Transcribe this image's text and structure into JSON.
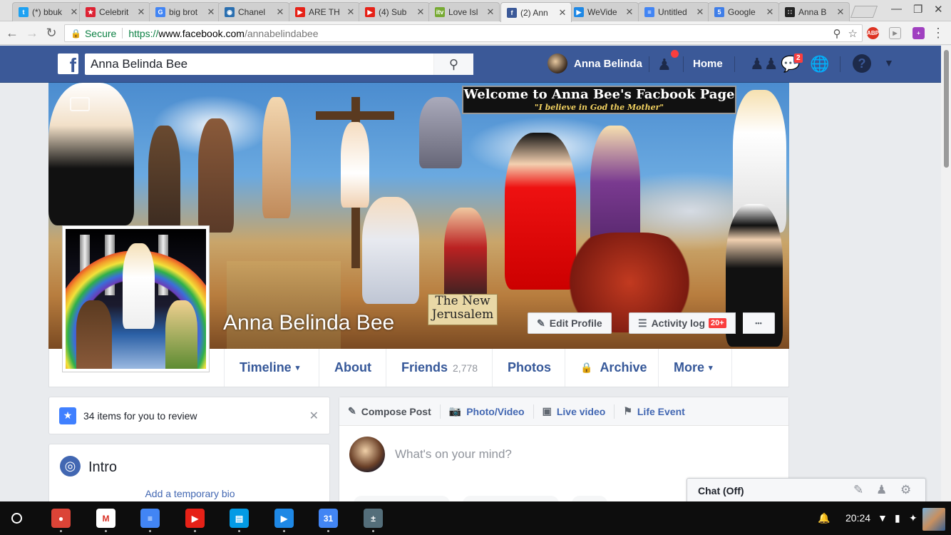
{
  "browser": {
    "tabs": [
      {
        "title": "(*) bbuk",
        "favicon": "twitter-icon",
        "color": "#1da1f2",
        "glyph": "t"
      },
      {
        "title": "Celebrit",
        "favicon": "celebrity-icon",
        "color": "#d23",
        "glyph": "★"
      },
      {
        "title": "big brot",
        "favicon": "google-icon",
        "color": "#4285f4",
        "glyph": "G"
      },
      {
        "title": "Chanel",
        "favicon": "eye-icon",
        "color": "#2a6fb0",
        "glyph": "◉"
      },
      {
        "title": "ARE TH",
        "favicon": "youtube-icon",
        "color": "#e62117",
        "glyph": "▶"
      },
      {
        "title": "(4) Sub",
        "favicon": "youtube-icon",
        "color": "#e62117",
        "glyph": "▶"
      },
      {
        "title": "Love Isl",
        "favicon": "itv-icon",
        "color": "#7a3",
        "glyph": "itv"
      },
      {
        "title": "(2) Ann",
        "favicon": "facebook-icon",
        "color": "#3b5998",
        "glyph": "f"
      },
      {
        "title": "WeVide",
        "favicon": "wevideo-icon",
        "color": "#1e88e5",
        "glyph": "▶"
      },
      {
        "title": "Untitled",
        "favicon": "docs-icon",
        "color": "#4285f4",
        "glyph": "≡"
      },
      {
        "title": "Google",
        "favicon": "sites-icon",
        "color": "#3f7ee8",
        "glyph": "5"
      },
      {
        "title": "Anna B",
        "favicon": "people-icon",
        "color": "#222",
        "glyph": "∷"
      }
    ],
    "url": {
      "secure_label": "Secure",
      "scheme": "https://",
      "domain": "www.facebook.com",
      "path": "/annabelindabee"
    },
    "extensions": [
      "abp-icon",
      "cast-icon",
      "puzzle-icon"
    ]
  },
  "fb_header": {
    "search_value": "Anna Belinda Bee",
    "user_name": "Anna Belinda",
    "home_label": "Home",
    "messages_count": "2"
  },
  "cover": {
    "caption_title": "Welcome to Anna Bee's Facbook Page",
    "caption_subtitle": "\"I believe in God the Mother\"",
    "sign_line1": "The New",
    "sign_line2": "Jerusalem",
    "profile_name": "Anna Belinda Bee",
    "edit_profile_label": "Edit Profile",
    "activity_log_label": "Activity log",
    "activity_badge": "20+",
    "more_dots": "•••"
  },
  "profile_nav": [
    {
      "label": "Timeline",
      "caret": "▾",
      "count": ""
    },
    {
      "label": "About",
      "caret": "",
      "count": ""
    },
    {
      "label": "Friends",
      "caret": "",
      "count": "2,778"
    },
    {
      "label": "Photos",
      "caret": "",
      "count": ""
    },
    {
      "label": "Archive",
      "caret": "",
      "count": ""
    },
    {
      "label": "More",
      "caret": "▾",
      "count": ""
    }
  ],
  "review": {
    "text": "34 items for you to review"
  },
  "intro": {
    "title": "Intro",
    "bio_link": "Add a temporary bio"
  },
  "composer": {
    "tabs": [
      "Compose Post",
      "Photo/Video",
      "Live video",
      "Life Event"
    ],
    "placeholder": "What's on your mind?"
  },
  "chat": {
    "label": "Chat (Off)"
  },
  "shelf": {
    "apps": [
      {
        "name": "chrome-app",
        "color": "#db4437",
        "glyph": "●"
      },
      {
        "name": "gmail-app",
        "color": "#ffffff",
        "glyph": "M"
      },
      {
        "name": "docs-app",
        "color": "#4285f4",
        "glyph": "≡"
      },
      {
        "name": "youtube-app",
        "color": "#e62117",
        "glyph": "▶"
      },
      {
        "name": "files-app",
        "color": "#039be5",
        "glyph": "▤"
      },
      {
        "name": "wevideo-app",
        "color": "#1e88e5",
        "glyph": "▶"
      },
      {
        "name": "calendar-app",
        "color": "#4285f4",
        "glyph": "31"
      },
      {
        "name": "calculator-app",
        "color": "#546e7a",
        "glyph": "±"
      }
    ],
    "time": "20:24"
  }
}
